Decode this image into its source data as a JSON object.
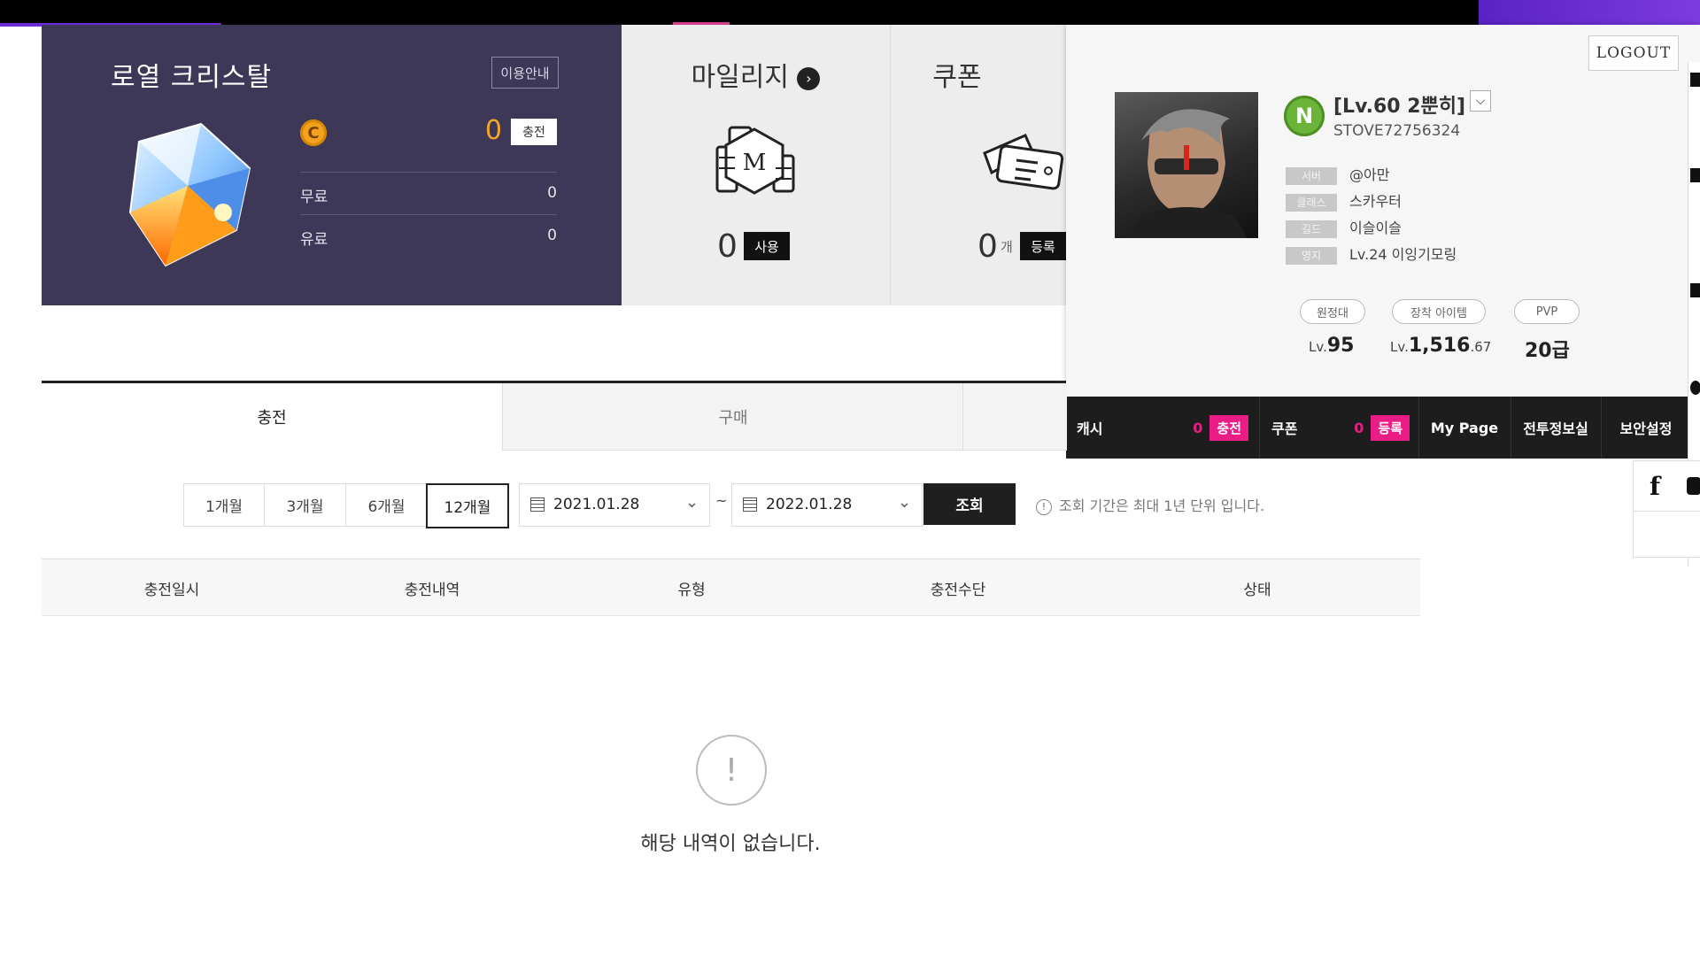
{
  "crystal": {
    "title": "로열 크리스탈",
    "info_label": "이용안내",
    "coin_symbol": "C",
    "total": "0",
    "charge_label": "충전",
    "free_label": "무료",
    "free_value": "0",
    "paid_label": "유료",
    "paid_value": "0"
  },
  "mileage": {
    "title": "마일리지",
    "arrow": "›",
    "badge_letter": "M",
    "value": "0",
    "use_label": "사용"
  },
  "coupon": {
    "title": "쿠폰",
    "value": "0",
    "unit": "개",
    "register_label": "등록"
  },
  "user": {
    "logout_label": "LOGOUT",
    "badge_letter": "N",
    "char_name": "[Lv.60 2뿐히]",
    "chevron": "⌵",
    "uid": "STOVE72756324",
    "info": [
      {
        "tag": "서버",
        "value": "@아만"
      },
      {
        "tag": "클래스",
        "value": "스카우터"
      },
      {
        "tag": "길드",
        "value": "이슬이슬"
      },
      {
        "tag": "영지",
        "value": "Lv.24 이잉기모링"
      }
    ],
    "stats": [
      {
        "pill": "원정대",
        "prefix": "Lv.",
        "main": "95",
        "suffix": ""
      },
      {
        "pill": "장착 아이템",
        "prefix": "Lv.",
        "main": "1,516",
        "suffix": ".67"
      },
      {
        "pill": "PVP",
        "prefix": "",
        "main": "20급",
        "suffix": ""
      }
    ],
    "bar": {
      "cash_label": "캐시",
      "cash_value": "0",
      "cash_btn": "충전",
      "coupon_label": "쿠폰",
      "coupon_value": "0",
      "coupon_btn": "등록",
      "mypage": "My Page",
      "battle_info": "전투정보실",
      "security": "보안설정"
    }
  },
  "tabs": {
    "charge": "충전",
    "buy": "구매"
  },
  "filters": {
    "periods": [
      "1개월",
      "3개월",
      "6개월",
      "12개월"
    ],
    "active_period": "12개월",
    "start_date": "2021.01.28",
    "tilde": "~",
    "end_date": "2022.01.28",
    "search_label": "조회",
    "notice": "조회 기간은 최대 1년 단위 입니다."
  },
  "table": {
    "headers": [
      "충전일시",
      "충전내역",
      "유형",
      "충전수단",
      "상태"
    ]
  },
  "empty": {
    "icon": "!",
    "message": "해당 내역이 없습니다."
  },
  "colors": {
    "crystal_bg": "#3d3858",
    "accent_orange": "#f5a623",
    "pink": "#ec1c86",
    "purple": "#6b2bd9"
  }
}
